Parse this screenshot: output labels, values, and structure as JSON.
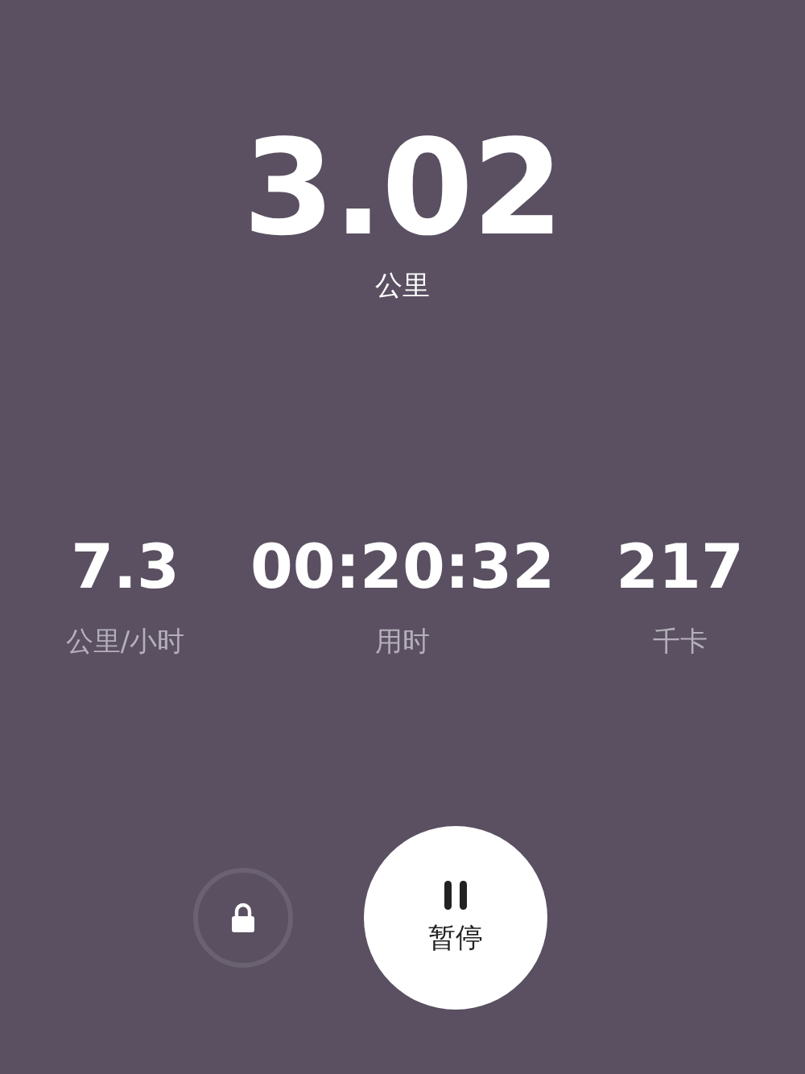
{
  "distance": {
    "value": "3.02",
    "unit": "公里"
  },
  "stats": [
    {
      "value": "7.3",
      "label": "公里/小时"
    },
    {
      "value": "00:20:32",
      "label": "用时"
    },
    {
      "value": "217",
      "label": "千卡"
    }
  ],
  "controls": {
    "pause_label": "暂停"
  }
}
